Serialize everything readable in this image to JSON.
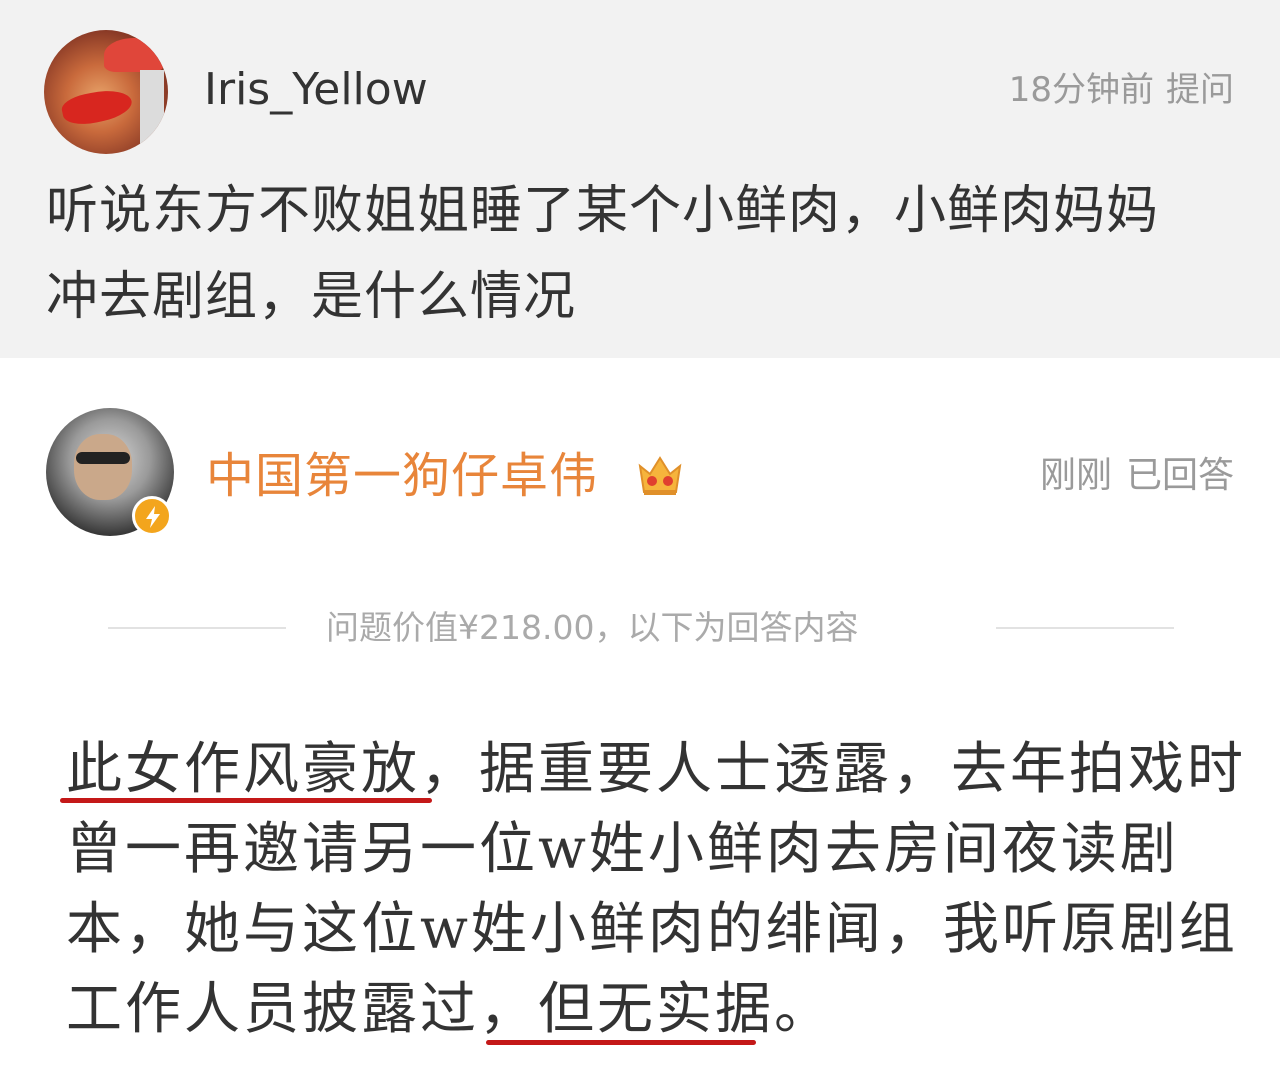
{
  "question": {
    "username": "Iris_Yellow",
    "time": "18分钟前",
    "type": "提问",
    "text_lines": [
      "听说东方不败姐姐睡了某个小鲜肉，小鲜肉妈妈",
      "冲去剧组，是什么情况"
    ]
  },
  "answer": {
    "username": "中国第一狗仔卓伟",
    "time": "刚刚",
    "status": "已回答",
    "divider_text": "问题价值¥218.00，以下为回答内容",
    "lines": [
      "此女作风豪放，据重要人士透露，去年拍戏时",
      "曾一再邀请另一位w姓小鲜肉去房间夜读剧",
      "本，她与这位w姓小鲜肉的绯闻，我听原剧组",
      "工作人员披露过，但无实据。"
    ]
  },
  "colors": {
    "question_bg": "#f2f2f2",
    "answer_username": "#e8853a",
    "underline": "#c41818",
    "meta": "#9a9a9a"
  },
  "icons": {
    "verify_badge": "verified-badge-icon",
    "crown": "crown-vip-icon"
  }
}
